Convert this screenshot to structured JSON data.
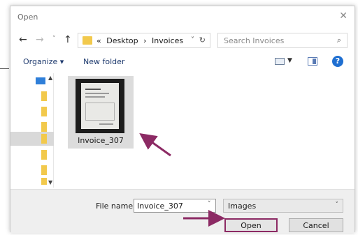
{
  "dialog": {
    "title": "Open",
    "close_glyph": "✕"
  },
  "nav": {
    "back_glyph": "←",
    "forward_glyph": "→",
    "recent_glyph": "˅",
    "up_glyph": "↑",
    "address": {
      "prefix": "«",
      "crumbs": [
        "Desktop",
        "›",
        "Invoices"
      ],
      "dropdown_glyph": "˅",
      "refresh_glyph": "↻"
    },
    "search_placeholder": "Search Invoices",
    "search_glyph": "⌕"
  },
  "toolbar": {
    "organize_label": "Organize ▾",
    "new_folder_label": "New folder",
    "view_dropdown_glyph": "▼",
    "help_glyph": "?"
  },
  "nav_pane": {
    "scroll_up_glyph": "▲",
    "scroll_down_glyph": "▼"
  },
  "files": [
    {
      "name": "Invoice_307"
    }
  ],
  "bottom": {
    "file_name_label": "File name:",
    "file_name_value": "Invoice_307",
    "file_name_dropdown_glyph": "˅",
    "file_type_value": "Images",
    "file_type_dropdown_glyph": "˅",
    "open_label": "Open",
    "cancel_label": "Cancel"
  },
  "colors": {
    "accent": "#1f6fd1",
    "folder": "#f2c94c",
    "annotation": "#8c2a64"
  }
}
